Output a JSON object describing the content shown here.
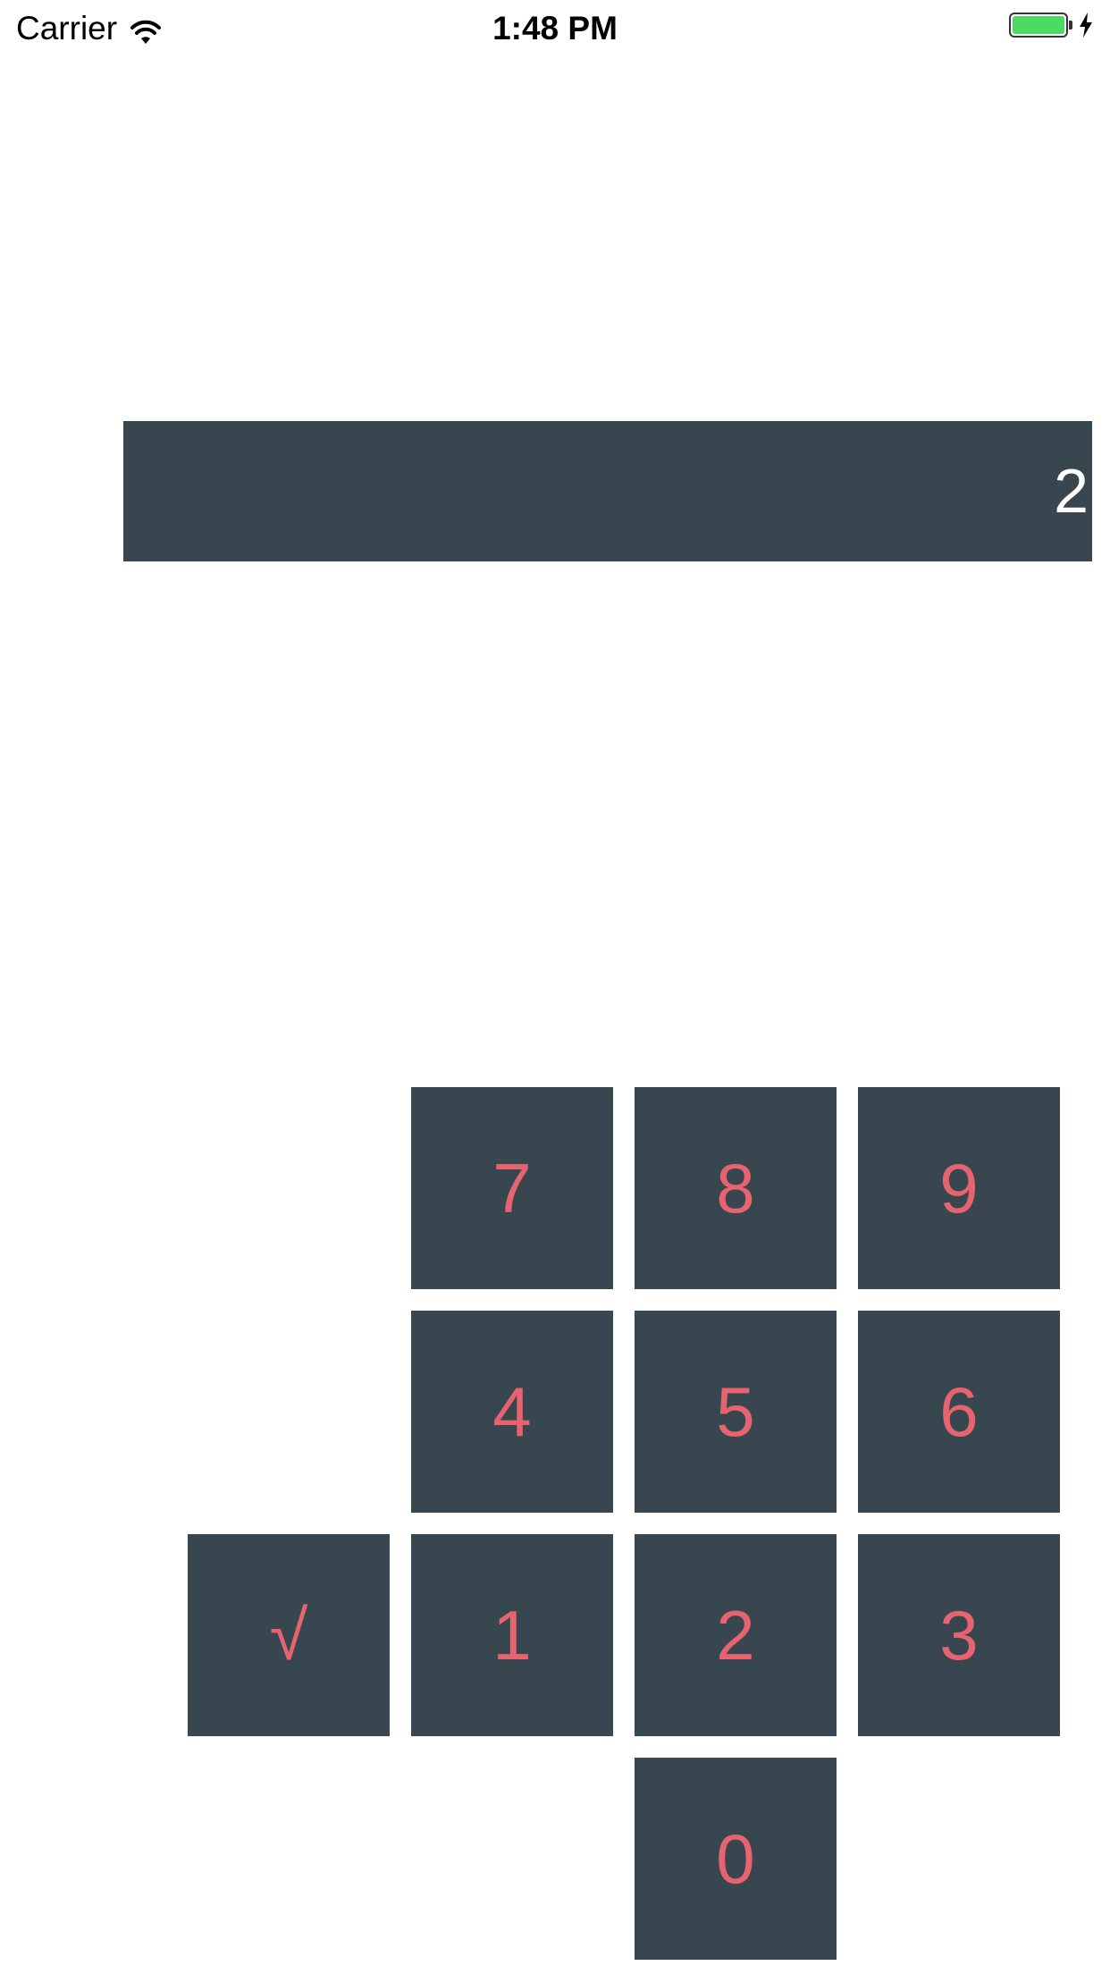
{
  "status_bar": {
    "carrier": "Carrier",
    "time": "1:48 PM",
    "battery_color": "#4cd964",
    "icons": [
      "wifi-icon",
      "battery-icon",
      "charging-bolt-icon"
    ]
  },
  "display": {
    "value": "2",
    "background": "#38474f",
    "text_color": "#ffffff"
  },
  "keypad": {
    "key_background": "#38474f",
    "key_text_color": "#e86370",
    "keys": {
      "k7": "7",
      "k8": "8",
      "k9": "9",
      "k4": "4",
      "k5": "5",
      "k6": "6",
      "sqrt": "√",
      "k1": "1",
      "k2": "2",
      "k3": "3",
      "k0": "0"
    }
  }
}
